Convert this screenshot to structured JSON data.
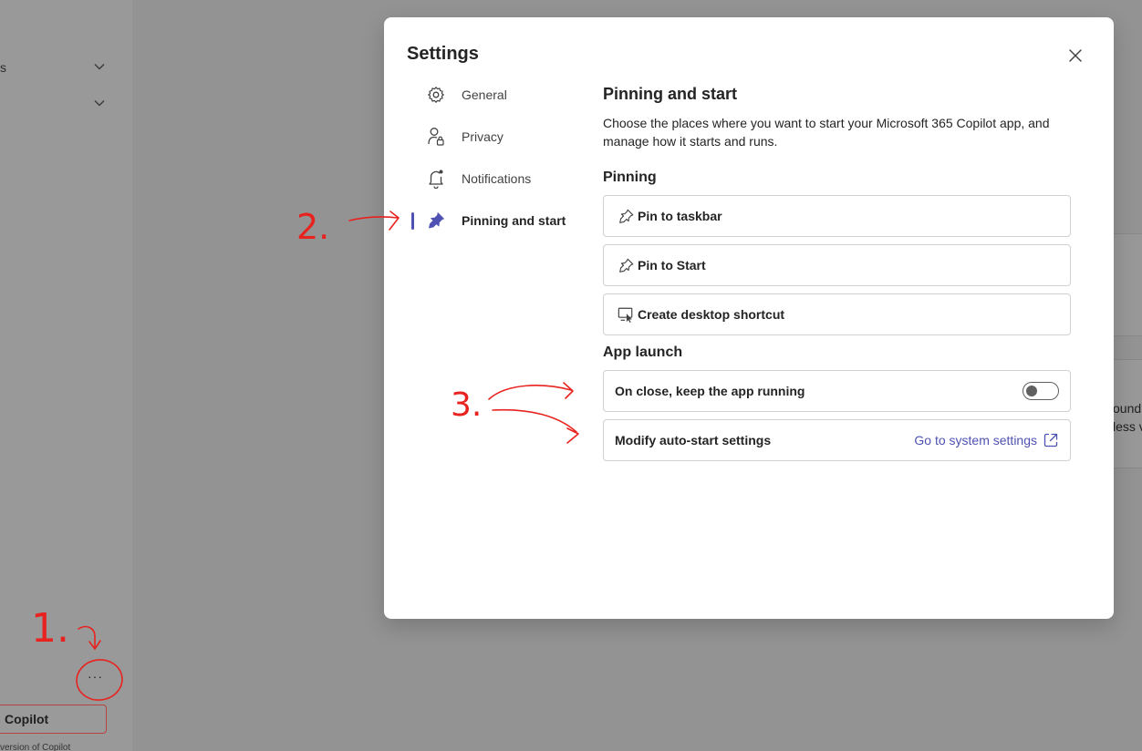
{
  "background": {
    "sidebar_rows": [
      "s",
      ""
    ],
    "more_label": "···",
    "copilot_button": "Copilot",
    "bottom_text": "version of Copilot",
    "partial_text_1": "ound",
    "partial_text_2": "less v"
  },
  "dialog": {
    "title": "Settings",
    "nav": [
      {
        "label": "General",
        "icon": "gear-icon"
      },
      {
        "label": "Privacy",
        "icon": "person-lock-icon"
      },
      {
        "label": "Notifications",
        "icon": "bell-icon"
      },
      {
        "label": "Pinning and start",
        "icon": "pin-icon",
        "active": true
      }
    ],
    "content": {
      "title": "Pinning and start",
      "description": "Choose the places where you want to start your Microsoft 365 Copilot app, and manage how it starts and runs.",
      "pinning_heading": "Pinning",
      "pin_taskbar": "Pin to taskbar",
      "pin_start": "Pin to Start",
      "desktop_shortcut": "Create desktop shortcut",
      "app_launch_heading": "App launch",
      "keep_running_label": "On close, keep the app running",
      "keep_running_on": false,
      "autostart_label": "Modify auto-start settings",
      "system_settings_link": "Go to system settings"
    }
  },
  "annotations": {
    "color": "#e8231f",
    "step1": "1.",
    "step2": "2.",
    "step3": "3."
  },
  "colors": {
    "accent": "#4f52b2",
    "overlay": "#929292"
  }
}
